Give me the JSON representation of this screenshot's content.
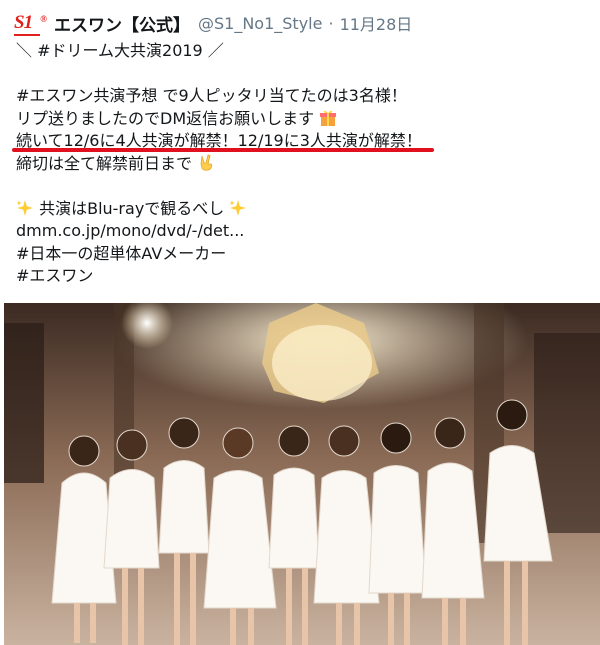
{
  "header": {
    "name": "エスワン【公式】",
    "handle": "@S1_No1_Style",
    "separator": "·",
    "date": "11月28日",
    "logo_text": "S1",
    "logo_sup": "®"
  },
  "tweet_lines": [
    "＼ #ドリーム大共演2019 ／",
    "",
    "#エスワン共演予想 で9人ピッタリ当てたのは3名様！",
    "リプ送りましたのでDM返信お願いします",
    "続いて12/6に4人共演が解禁！12/19に3人共演が解禁！",
    "締切は全て解禁前日まで",
    "",
    "共演はBlu-rayで観るべし",
    "dmm.co.jp/mono/dvd/-/det...",
    "#日本一の超単体AVメーカー",
    "#エスワン"
  ],
  "colors": {
    "brand_red": "#e0201b",
    "underline_red": "#e0101e",
    "text": "#14171a",
    "muted": "#657786"
  },
  "icons": [
    "gift-emoji",
    "victory-hand-emoji",
    "sparkles-emoji"
  ]
}
